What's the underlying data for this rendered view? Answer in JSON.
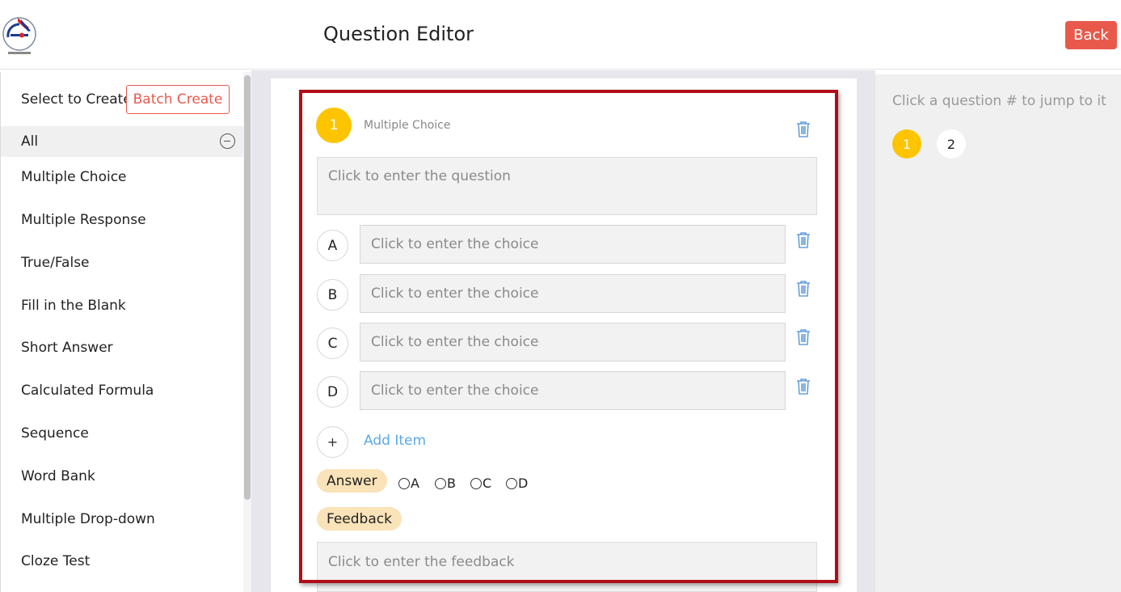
{
  "header": {
    "title": "Question Editor",
    "back_label": "Back"
  },
  "sidebar": {
    "select_label": "Select to Create",
    "batch_create_label": "Batch Create",
    "category_all": "All",
    "types": [
      "Multiple Choice",
      "Multiple Response",
      "True/False",
      "Fill in the Blank",
      "Short Answer",
      "Calculated Formula",
      "Sequence",
      "Word Bank",
      "Multiple Drop-down",
      "Cloze Test"
    ]
  },
  "question": {
    "number": "1",
    "type": "Multiple Choice",
    "placeholder": "Click to enter the question",
    "choices": [
      {
        "letter": "A",
        "placeholder": "Click to enter the choice"
      },
      {
        "letter": "B",
        "placeholder": "Click to enter the choice"
      },
      {
        "letter": "C",
        "placeholder": "Click to enter the choice"
      },
      {
        "letter": "D",
        "placeholder": "Click to enter the choice"
      }
    ],
    "add_symbol": "+",
    "add_item_label": "Add Item",
    "answer_label": "Answer",
    "answer_options": [
      "A",
      "B",
      "C",
      "D"
    ],
    "feedback_label": "Feedback",
    "feedback_placeholder": "Click to enter the feedback"
  },
  "navigator": {
    "hint": "Click a question # to jump to it",
    "numbers": [
      "1",
      "2"
    ],
    "active_color": "#fdc400"
  },
  "colors": {
    "accent_red": "#e8594c",
    "link_blue": "#5ca8e6",
    "highlight_border": "#b00d16"
  }
}
